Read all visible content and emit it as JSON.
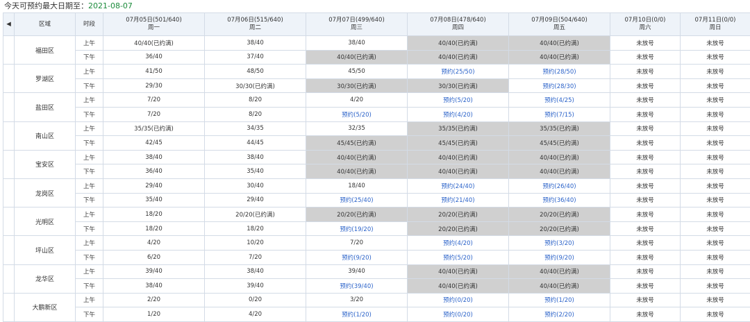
{
  "header_text": "今天可预约最大日期至：",
  "max_date": "2021-08-07",
  "table": {
    "head": {
      "district_label": "区域",
      "period_label": "时段"
    },
    "days": [
      {
        "date": "07月05日(501/640)",
        "weekday": "周一"
      },
      {
        "date": "07月06日(515/640)",
        "weekday": "周二"
      },
      {
        "date": "07月07日(499/640)",
        "weekday": "周三"
      },
      {
        "date": "07月08日(478/640)",
        "weekday": "周四"
      },
      {
        "date": "07月09日(504/640)",
        "weekday": "周五"
      },
      {
        "date": "07月10日(0/0)",
        "weekday": "周六"
      },
      {
        "date": "07月11日(0/0)",
        "weekday": "周日"
      }
    ],
    "periods": {
      "am": "上午",
      "pm": "下午"
    },
    "districts": [
      {
        "name": "福田区",
        "rows": [
          [
            "40/40(已约满)",
            "38/40",
            "38/40",
            "40/40(已约满)",
            "40/40(已约满)",
            "未放号",
            "未放号"
          ],
          [
            "36/40",
            "37/40",
            "40/40(已约满)",
            "40/40(已约满)",
            "40/40(已约满)",
            "未放号",
            "未放号"
          ]
        ]
      },
      {
        "name": "罗湖区",
        "rows": [
          [
            "41/50",
            "48/50",
            "45/50",
            "预约(25/50)",
            "预约(28/50)",
            "未放号",
            "未放号"
          ],
          [
            "29/30",
            "30/30(已约满)",
            "30/30(已约满)",
            "30/30(已约满)",
            "预约(28/30)",
            "未放号",
            "未放号"
          ]
        ]
      },
      {
        "name": "盐田区",
        "rows": [
          [
            "7/20",
            "8/20",
            "4/20",
            "预约(5/20)",
            "预约(4/25)",
            "未放号",
            "未放号"
          ],
          [
            "7/20",
            "8/20",
            "预约(5/20)",
            "预约(4/20)",
            "预约(7/15)",
            "未放号",
            "未放号"
          ]
        ]
      },
      {
        "name": "南山区",
        "rows": [
          [
            "35/35(已约满)",
            "34/35",
            "32/35",
            "35/35(已约满)",
            "35/35(已约满)",
            "未放号",
            "未放号"
          ],
          [
            "42/45",
            "44/45",
            "45/45(已约满)",
            "45/45(已约满)",
            "45/45(已约满)",
            "未放号",
            "未放号"
          ]
        ]
      },
      {
        "name": "宝安区",
        "rows": [
          [
            "38/40",
            "38/40",
            "40/40(已约满)",
            "40/40(已约满)",
            "40/40(已约满)",
            "未放号",
            "未放号"
          ],
          [
            "36/40",
            "35/40",
            "40/40(已约满)",
            "40/40(已约满)",
            "40/40(已约满)",
            "未放号",
            "未放号"
          ]
        ]
      },
      {
        "name": "龙岗区",
        "rows": [
          [
            "29/40",
            "30/40",
            "18/40",
            "预约(24/40)",
            "预约(26/40)",
            "未放号",
            "未放号"
          ],
          [
            "35/40",
            "29/40",
            "预约(25/40)",
            "预约(21/40)",
            "预约(36/40)",
            "未放号",
            "未放号"
          ]
        ]
      },
      {
        "name": "光明区",
        "rows": [
          [
            "18/20",
            "20/20(已约满)",
            "20/20(已约满)",
            "20/20(已约满)",
            "20/20(已约满)",
            "未放号",
            "未放号"
          ],
          [
            "18/20",
            "18/20",
            "预约(19/20)",
            "20/20(已约满)",
            "20/20(已约满)",
            "未放号",
            "未放号"
          ]
        ]
      },
      {
        "name": "坪山区",
        "rows": [
          [
            "4/20",
            "10/20",
            "7/20",
            "预约(4/20)",
            "预约(3/20)",
            "未放号",
            "未放号"
          ],
          [
            "6/20",
            "7/20",
            "预约(9/20)",
            "预约(5/20)",
            "预约(9/20)",
            "未放号",
            "未放号"
          ]
        ]
      },
      {
        "name": "龙华区",
        "rows": [
          [
            "39/40",
            "38/40",
            "39/40",
            "40/40(已约满)",
            "40/40(已约满)",
            "未放号",
            "未放号"
          ],
          [
            "38/40",
            "39/40",
            "预约(39/40)",
            "40/40(已约满)",
            "40/40(已约满)",
            "未放号",
            "未放号"
          ]
        ]
      },
      {
        "name": "大鹏新区",
        "rows": [
          [
            "2/20",
            "0/20",
            "3/20",
            "预约(0/20)",
            "预约(1/20)",
            "未放号",
            "未放号"
          ],
          [
            "1/20",
            "4/20",
            "预约(1/20)",
            "预约(0/20)",
            "预约(2/20)",
            "未放号",
            "未放号"
          ]
        ]
      }
    ]
  }
}
